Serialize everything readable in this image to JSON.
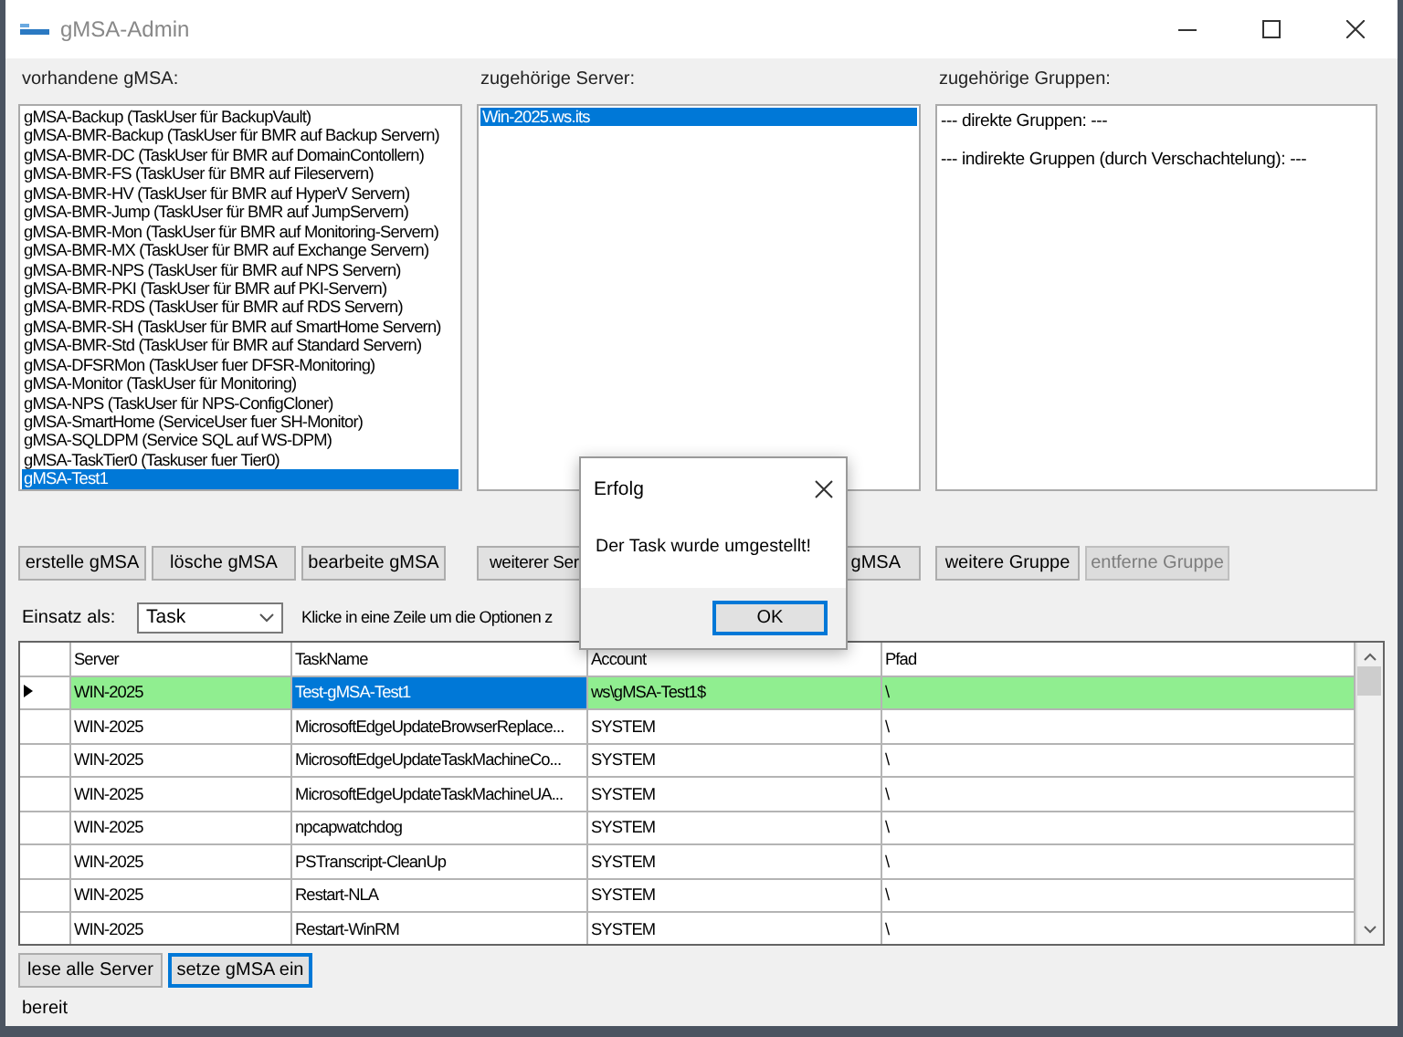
{
  "window": {
    "title": "gMSA-Admin"
  },
  "gmsa_panel": {
    "label": "vorhandene gMSA:",
    "items": [
      {
        "label": "gMSA-Backup (TaskUser für BackupVault)",
        "selected": false
      },
      {
        "label": "gMSA-BMR-Backup (TaskUser für BMR auf Backup Servern)",
        "selected": false
      },
      {
        "label": "gMSA-BMR-DC (TaskUser für BMR auf DomainContollern)",
        "selected": false
      },
      {
        "label": "gMSA-BMR-FS (TaskUser für BMR auf Fileservern)",
        "selected": false
      },
      {
        "label": "gMSA-BMR-HV (TaskUser für BMR auf HyperV Servern)",
        "selected": false
      },
      {
        "label": "gMSA-BMR-Jump (TaskUser für BMR auf JumpServern)",
        "selected": false
      },
      {
        "label": "gMSA-BMR-Mon (TaskUser für BMR auf Monitoring-Servern)",
        "selected": false
      },
      {
        "label": "gMSA-BMR-MX (TaskUser für BMR auf Exchange Servern)",
        "selected": false
      },
      {
        "label": "gMSA-BMR-NPS (TaskUser für BMR auf NPS Servern)",
        "selected": false
      },
      {
        "label": "gMSA-BMR-PKI (TaskUser für BMR auf PKI-Servern)",
        "selected": false
      },
      {
        "label": "gMSA-BMR-RDS (TaskUser für BMR auf RDS Servern)",
        "selected": false
      },
      {
        "label": "gMSA-BMR-SH (TaskUser für BMR auf SmartHome Servern)",
        "selected": false
      },
      {
        "label": "gMSA-BMR-Std (TaskUser für BMR auf Standard Servern)",
        "selected": false
      },
      {
        "label": "gMSA-DFSRMon (TaskUser fuer DFSR-Monitoring)",
        "selected": false
      },
      {
        "label": "gMSA-Monitor (TaskUser für Monitoring)",
        "selected": false
      },
      {
        "label": "gMSA-NPS (TaskUser für NPS-ConfigCloner)",
        "selected": false
      },
      {
        "label": "gMSA-SmartHome (ServiceUser fuer SH-Monitor)",
        "selected": false
      },
      {
        "label": "gMSA-SQLDPM (Service SQL auf WS-DPM)",
        "selected": false
      },
      {
        "label": "gMSA-TaskTier0 (Taskuser fuer Tier0)",
        "selected": false
      },
      {
        "label": "gMSA-Test1",
        "selected": true
      }
    ],
    "buttons": [
      {
        "label": "erstelle gMSA",
        "disabled": false,
        "focused": false
      },
      {
        "label": "lösche gMSA",
        "disabled": false,
        "focused": false
      },
      {
        "label": "bearbeite gMSA",
        "disabled": false,
        "focused": false
      }
    ]
  },
  "server_panel": {
    "label": "zugehörige Server:",
    "items": [
      {
        "label": "Win-2025.ws.its",
        "selected": true
      }
    ],
    "buttons": [
      {
        "label": "weiterer Ser",
        "disabled": false,
        "focused": false
      },
      {
        "label": "gMSA",
        "disabled": false,
        "focused": false
      }
    ]
  },
  "group_panel": {
    "label": "zugehörige Gruppen:",
    "lines": [
      "--- direkte Gruppen: ---",
      "--- indirekte Gruppen (durch Verschachtelung): ---"
    ],
    "buttons": [
      {
        "label": "weitere Gruppe",
        "disabled": false,
        "focused": false
      },
      {
        "label": "entferne Gruppe",
        "disabled": true,
        "focused": false
      }
    ]
  },
  "usage": {
    "label": "Einsatz als:",
    "value": "Task",
    "hint": "Klicke in eine Zeile um die Optionen z"
  },
  "table": {
    "columns": [
      "Server",
      "TaskName",
      "Account",
      "Pfad"
    ],
    "rows": [
      {
        "selected": true,
        "cells": [
          {
            "text": "WIN-2025",
            "selected": false
          },
          {
            "text": "Test-gMSA-Test1",
            "selected": true
          },
          {
            "text": "ws\\gMSA-Test1$",
            "selected": false
          },
          {
            "text": "\\",
            "selected": false
          }
        ]
      },
      {
        "selected": false,
        "cells": [
          {
            "text": "WIN-2025",
            "selected": false
          },
          {
            "text": "MicrosoftEdgeUpdateBrowserReplace...",
            "selected": false
          },
          {
            "text": "SYSTEM",
            "selected": false
          },
          {
            "text": "\\",
            "selected": false
          }
        ]
      },
      {
        "selected": false,
        "cells": [
          {
            "text": "WIN-2025",
            "selected": false
          },
          {
            "text": "MicrosoftEdgeUpdateTaskMachineCo...",
            "selected": false
          },
          {
            "text": "SYSTEM",
            "selected": false
          },
          {
            "text": "\\",
            "selected": false
          }
        ]
      },
      {
        "selected": false,
        "cells": [
          {
            "text": "WIN-2025",
            "selected": false
          },
          {
            "text": "MicrosoftEdgeUpdateTaskMachineUA...",
            "selected": false
          },
          {
            "text": "SYSTEM",
            "selected": false
          },
          {
            "text": "\\",
            "selected": false
          }
        ]
      },
      {
        "selected": false,
        "cells": [
          {
            "text": "WIN-2025",
            "selected": false
          },
          {
            "text": "npcapwatchdog",
            "selected": false
          },
          {
            "text": "SYSTEM",
            "selected": false
          },
          {
            "text": "\\",
            "selected": false
          }
        ]
      },
      {
        "selected": false,
        "cells": [
          {
            "text": "WIN-2025",
            "selected": false
          },
          {
            "text": "PSTranscript-CleanUp",
            "selected": false
          },
          {
            "text": "SYSTEM",
            "selected": false
          },
          {
            "text": "\\",
            "selected": false
          }
        ]
      },
      {
        "selected": false,
        "cells": [
          {
            "text": "WIN-2025",
            "selected": false
          },
          {
            "text": "Restart-NLA",
            "selected": false
          },
          {
            "text": "SYSTEM",
            "selected": false
          },
          {
            "text": "\\",
            "selected": false
          }
        ]
      },
      {
        "selected": false,
        "cells": [
          {
            "text": "WIN-2025",
            "selected": false
          },
          {
            "text": "Restart-WinRM",
            "selected": false
          },
          {
            "text": "SYSTEM",
            "selected": false
          },
          {
            "text": "\\",
            "selected": false
          }
        ]
      }
    ]
  },
  "bottom_buttons": [
    {
      "label": "lese alle Server",
      "disabled": false,
      "focused": false
    },
    {
      "label": "setze gMSA ein",
      "disabled": false,
      "focused": true
    }
  ],
  "status_bar": "bereit",
  "dialog": {
    "title": "Erfolg",
    "message": "Der Task wurde umgestellt!",
    "button": "OK"
  }
}
